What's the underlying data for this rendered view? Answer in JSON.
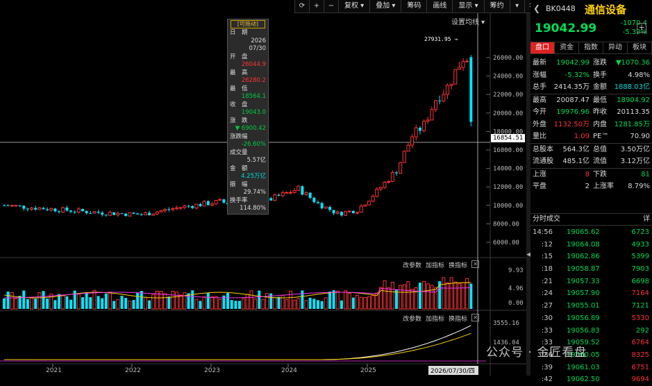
{
  "toolbar": {
    "items": [
      "复权",
      "叠加",
      "筹码",
      "画线",
      "显示",
      "筹约"
    ]
  },
  "chart": {
    "ma_setting_label": "设置均线",
    "peak_label": "27931.95",
    "crosshair_price": "16854.51",
    "price_axis": [
      "26000.00",
      "24000.00",
      "22000.00",
      "20000.00",
      "18000.00",
      "16000.00",
      "14000.00",
      "12000.00",
      "10000.00",
      "8000.00",
      "6000.00"
    ],
    "vol_axis": [
      "9.93",
      "4.96",
      "0.00"
    ],
    "amt_axis": [
      "3555.16",
      "1436.04"
    ],
    "x_axis": [
      "2021",
      "2022",
      "2023",
      "2024",
      "2025"
    ],
    "x_cursor": "2026/07/30/四",
    "sub_tools": [
      "改参数",
      "加指标",
      "换指标"
    ],
    "colors": {
      "up": "#ff3333",
      "down": "#00e5ff",
      "ma_white": "#ffffff",
      "ma_yellow": "#ffd200",
      "ma_purple": "#ff33ff"
    }
  },
  "tooltip": {
    "badge": "[可拖动]",
    "date_label": "日　期",
    "date_year": "2026",
    "date_md": "07/30",
    "open_label": "开　盘",
    "open": "26044.9",
    "high_label": "最　高",
    "high": "26280.2",
    "low_label": "最　低",
    "low": "18564.1",
    "close_label": "收　盘",
    "close": "19043.0",
    "change_label": "涨　跌",
    "change": "▼ 6900.42",
    "pct_label": "涨跌幅",
    "pct": "-26.60%",
    "vol_label": "成交量",
    "vol": "5.57亿",
    "amt_label": "金　额",
    "amt": "4.25万亿",
    "amp_label": "振　幅",
    "amp": "29.74%",
    "turn_label": "换手率",
    "turn": "114.80%"
  },
  "panel": {
    "code": "BK0448",
    "name": "通信设备",
    "price": "19042.99",
    "change": "-1070.4",
    "pct": "-5.32%",
    "tabs": [
      "盘口",
      "资金",
      "指数",
      "异动",
      "板块"
    ],
    "quote": [
      [
        {
          "l": "最新",
          "v": "19042.99",
          "c": "down"
        },
        {
          "l": "涨跌",
          "v": "▼1070.36",
          "c": "down"
        }
      ],
      [
        {
          "l": "涨幅",
          "v": "-5.32%",
          "c": "down"
        },
        {
          "l": "换手",
          "v": "4.98%",
          "c": "white"
        }
      ],
      [
        {
          "l": "总手",
          "v": "2414.35万",
          "c": "white"
        },
        {
          "l": "金额",
          "v": "1888.03亿",
          "c": "cyan"
        }
      ],
      [
        {
          "l": "最高",
          "v": "20087.47",
          "c": "white"
        },
        {
          "l": "最低",
          "v": "18904.92",
          "c": "down"
        }
      ],
      [
        {
          "l": "今开",
          "v": "19976.96",
          "c": "down"
        },
        {
          "l": "昨收",
          "v": "20113.35",
          "c": "white"
        }
      ],
      [
        {
          "l": "外盘",
          "v": "1132.50万",
          "c": "up"
        },
        {
          "l": "内盘",
          "v": "1281.85万",
          "c": "down"
        }
      ],
      [
        {
          "l": "量比",
          "v": "1.09",
          "c": "up"
        },
        {
          "l": "PE™",
          "v": "70.90",
          "c": "white"
        }
      ],
      [
        {
          "l": "总股本",
          "v": "564.3亿",
          "c": "white"
        },
        {
          "l": "总值",
          "v": "3.50万亿",
          "c": "white"
        }
      ],
      [
        {
          "l": "流通股",
          "v": "485.1亿",
          "c": "white"
        },
        {
          "l": "流值",
          "v": "3.12万亿",
          "c": "white"
        }
      ],
      [
        {
          "l": "上涨",
          "v": "8",
          "c": "up"
        },
        {
          "l": "下跌",
          "v": "81",
          "c": "down"
        }
      ],
      [
        {
          "l": "平盘",
          "v": "2",
          "c": "white"
        },
        {
          "l": "上涨率",
          "v": "8.79%",
          "c": "white"
        }
      ]
    ],
    "ts_title": "分时成交",
    "ts_right": "详",
    "ticks": [
      {
        "t": "14:56",
        "p": "19065.62",
        "v": "6723",
        "c": "down"
      },
      {
        "t": ":12",
        "p": "19064.08",
        "v": "4933",
        "c": "down"
      },
      {
        "t": ":15",
        "p": "19062.86",
        "v": "5399",
        "c": "down"
      },
      {
        "t": ":18",
        "p": "19058.87",
        "v": "7903",
        "c": "down"
      },
      {
        "t": ":21",
        "p": "19057.33",
        "v": "6698",
        "c": "down"
      },
      {
        "t": ":24",
        "p": "19057.90",
        "v": "7164",
        "c": "up"
      },
      {
        "t": ":27",
        "p": "19055.01",
        "v": "7121",
        "c": "down"
      },
      {
        "t": ":30",
        "p": "19056.89",
        "v": "5330",
        "c": "up"
      },
      {
        "t": ":33",
        "p": "19056.83",
        "v": "292",
        "c": "down"
      },
      {
        "t": ":33",
        "p": "19059.52",
        "v": "6764",
        "c": "up"
      },
      {
        "t": ":36",
        "p": "19060.05",
        "v": "8325",
        "c": "up"
      },
      {
        "t": ":39",
        "p": "19061.03",
        "v": "6751",
        "c": "up"
      },
      {
        "t": ":42",
        "p": "19062.50",
        "v": "9694",
        "c": "up"
      }
    ]
  },
  "watermark": "公众号 · 金匠看盘"
}
